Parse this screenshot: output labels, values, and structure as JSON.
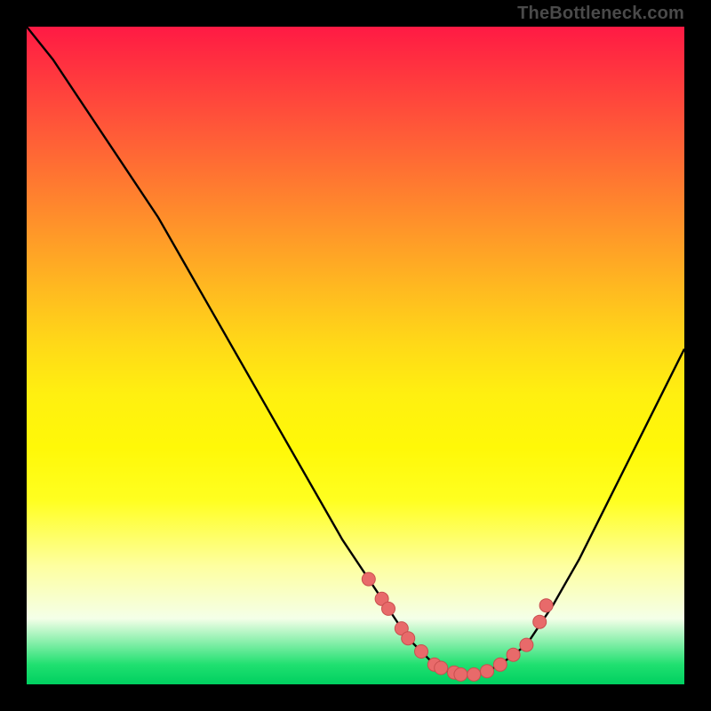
{
  "watermark": "TheBottleneck.com",
  "colors": {
    "curve": "#000000",
    "marker_fill": "#e86a6a",
    "marker_stroke": "#c94f4f"
  },
  "chart_data": {
    "type": "line",
    "title": "",
    "xlabel": "",
    "ylabel": "",
    "xlim": [
      0,
      100
    ],
    "ylim": [
      0,
      100
    ],
    "series": [
      {
        "name": "bottleneck-curve",
        "x": [
          0,
          4,
          8,
          12,
          16,
          20,
          24,
          28,
          32,
          36,
          40,
          44,
          48,
          52,
          56,
          58,
          60,
          62,
          64,
          66,
          68,
          70,
          72,
          76,
          80,
          84,
          88,
          92,
          96,
          100
        ],
        "values": [
          100,
          95,
          89,
          83,
          77,
          71,
          64,
          57,
          50,
          43,
          36,
          29,
          22,
          16,
          10,
          7,
          5,
          3,
          2,
          1.5,
          1.5,
          2,
          3,
          6,
          12,
          19,
          27,
          35,
          43,
          51
        ]
      }
    ],
    "markers": {
      "name": "highlight-points",
      "x": [
        52,
        54,
        55,
        57,
        58,
        60,
        62,
        63,
        65,
        66,
        68,
        70,
        72,
        74,
        76,
        78,
        79
      ],
      "values": [
        16,
        13,
        11.5,
        8.5,
        7,
        5,
        3,
        2.5,
        1.8,
        1.5,
        1.5,
        2,
        3,
        4.5,
        6,
        9.5,
        12
      ]
    }
  }
}
